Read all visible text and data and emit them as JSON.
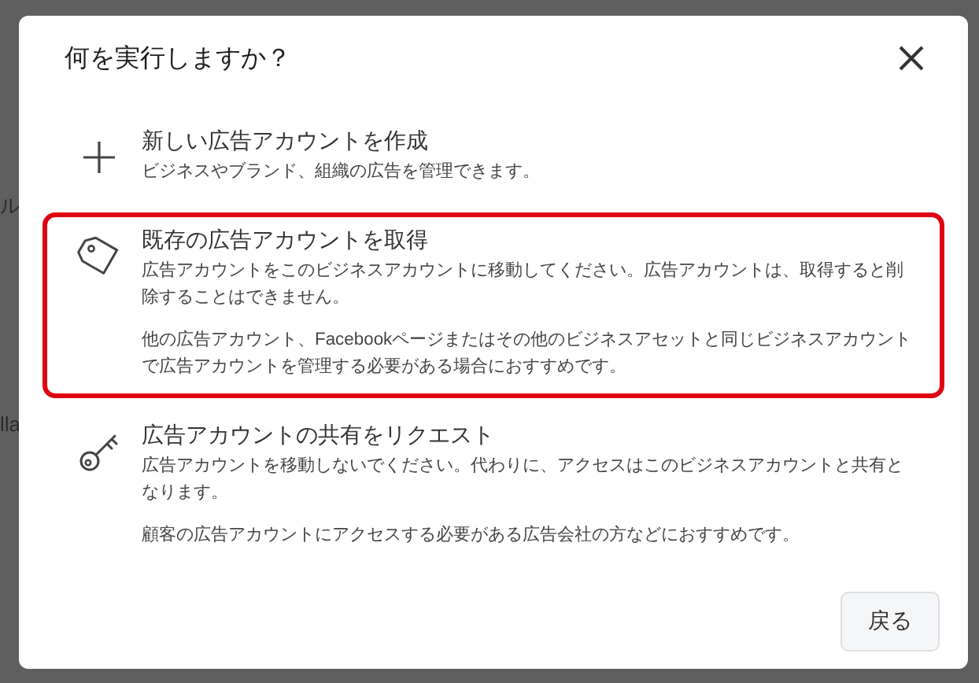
{
  "background": {
    "fragments": [
      "ル",
      "lla"
    ]
  },
  "dialog": {
    "title": "何を実行しますか？",
    "options": [
      {
        "kind": "create",
        "title": "新しい広告アカウントを作成",
        "paragraphs": [
          "ビジネスやブランド、組織の広告を管理できます。"
        ],
        "highlighted": false
      },
      {
        "kind": "claim",
        "title": "既存の広告アカウントを取得",
        "paragraphs": [
          "広告アカウントをこのビジネスアカウントに移動してください。広告アカウントは、取得すると削除することはできません。",
          "他の広告アカウント、Facebookページまたはその他のビジネスアセットと同じビジネスアカウントで広告アカウントを管理する必要がある場合におすすめです。"
        ],
        "highlighted": true
      },
      {
        "kind": "request",
        "title": "広告アカウントの共有をリクエスト",
        "paragraphs": [
          "広告アカウントを移動しないでください。代わりに、アクセスはこのビジネスアカウントと共有となります。",
          "顧客の広告アカウントにアクセスする必要がある広告会社の方などにおすすめです。"
        ],
        "highlighted": false
      }
    ],
    "buttons": [
      "戻る"
    ]
  }
}
